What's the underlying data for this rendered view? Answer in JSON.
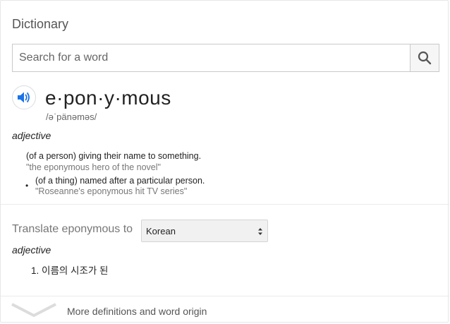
{
  "title": "Dictionary",
  "search": {
    "placeholder": "Search for a word"
  },
  "entry": {
    "headword": "e·pon·y·mous",
    "phonetic": "/əˈpänəməs/",
    "part_of_speech": "adjective",
    "definitions": [
      {
        "text": "(of a person) giving their name to something.",
        "example": "\"the eponymous hero of the novel\""
      },
      {
        "text": "(of a thing) named after a particular person.",
        "example": "\"Roseanne's eponymous hit TV series\""
      }
    ]
  },
  "translate": {
    "label": "Translate eponymous to",
    "selected_language": "Korean",
    "part_of_speech": "adjective",
    "items": [
      {
        "number": "1.",
        "text": "이름의 시조가 된"
      }
    ]
  },
  "footer": {
    "more_label": "More definitions and word origin"
  },
  "colors": {
    "accent": "#1a73e8",
    "divider": "#ebebeb"
  }
}
